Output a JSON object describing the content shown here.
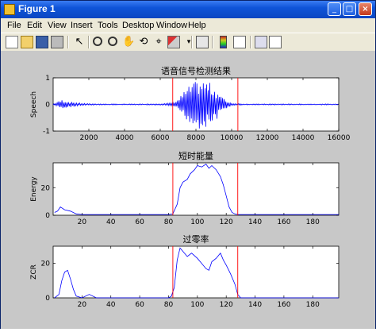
{
  "window": {
    "title": "Figure 1",
    "minimize": "_",
    "maximize": "□",
    "close": "×"
  },
  "menu": [
    "File",
    "Edit",
    "View",
    "Insert",
    "Tools",
    "Desktop",
    "Window",
    "Help"
  ],
  "toolbar": [
    "new-figure-icon",
    "open-file-icon",
    "save-icon",
    "print-icon",
    "edit-plot-arrow-icon",
    "zoom-in-icon",
    "zoom-out-icon",
    "pan-hand-icon",
    "rotate-3d-icon",
    "data-cursor-icon",
    "brush-icon",
    "link-icon",
    "colorbar-icon",
    "legend-icon",
    "hide-plot-tools-icon",
    "show-plot-tools-icon"
  ],
  "colors": {
    "signal": "#0000ff",
    "marker": "#ff0000",
    "figure_bg": "#c8c8c8",
    "axes_bg": "#ffffff"
  },
  "chart_data": [
    {
      "type": "line",
      "title": "语音信号检测结果",
      "xlabel": "",
      "ylabel": "Speech",
      "xlim": [
        0,
        16000
      ],
      "ylim": [
        -1,
        1
      ],
      "xticks": [
        "2000",
        "4000",
        "6000",
        "8000",
        "10000",
        "12000",
        "14000",
        "16000"
      ],
      "yticks": [
        "-1",
        "0",
        "1"
      ],
      "envelope": {
        "x": [
          0,
          500,
          1000,
          1500,
          2000,
          3000,
          4000,
          5000,
          6000,
          6500,
          7000,
          7400,
          7800,
          8200,
          8600,
          9000,
          9300,
          9600,
          10000,
          10500,
          11000,
          12000,
          13000,
          14000,
          15000,
          16000
        ],
        "amplitude": [
          0.02,
          0.18,
          0.1,
          0.05,
          0.03,
          0.02,
          0.02,
          0.02,
          0.03,
          0.05,
          0.2,
          0.55,
          0.8,
          0.92,
          0.9,
          0.7,
          0.45,
          0.2,
          0.05,
          0.03,
          0.02,
          0.02,
          0.02,
          0.02,
          0.02,
          0.02
        ]
      },
      "markers": [
        6700,
        10350
      ]
    },
    {
      "type": "line",
      "title": "短时能量",
      "xlabel": "",
      "ylabel": "Energy",
      "xlim": [
        0,
        198
      ],
      "ylim": [
        0,
        38
      ],
      "xticks": [
        "20",
        "40",
        "60",
        "80",
        "100",
        "120",
        "140",
        "160",
        "180"
      ],
      "yticks": [
        "0",
        "20"
      ],
      "x": [
        1,
        3,
        5,
        8,
        12,
        16,
        20,
        30,
        40,
        60,
        80,
        83,
        86,
        88,
        90,
        93,
        95,
        98,
        100,
        103,
        106,
        108,
        110,
        113,
        116,
        118,
        120,
        122,
        124,
        126,
        128,
        130,
        140,
        160,
        198
      ],
      "y": [
        2,
        3,
        6,
        4,
        3,
        1,
        0.5,
        0.5,
        0.5,
        0.5,
        0.5,
        1,
        8,
        20,
        24,
        26,
        30,
        33,
        36,
        35,
        37,
        34,
        36,
        33,
        28,
        22,
        14,
        6,
        2,
        1,
        0.5,
        0.5,
        0.5,
        0.5,
        0.5
      ],
      "markers": [
        83,
        128
      ]
    },
    {
      "type": "line",
      "title": "过零率",
      "xlabel": "",
      "ylabel": "ZCR",
      "xlim": [
        0,
        198
      ],
      "ylim": [
        0,
        30
      ],
      "xticks": [
        "20",
        "40",
        "60",
        "80",
        "100",
        "120",
        "140",
        "160",
        "180"
      ],
      "yticks": [
        "0",
        "20"
      ],
      "x": [
        1,
        4,
        6,
        8,
        10,
        12,
        14,
        16,
        20,
        25,
        30,
        40,
        60,
        80,
        82,
        84,
        86,
        88,
        90,
        93,
        96,
        100,
        103,
        106,
        108,
        110,
        113,
        116,
        118,
        120,
        123,
        126,
        128,
        130,
        140,
        160,
        198
      ],
      "y": [
        0,
        2,
        10,
        15,
        16,
        11,
        5,
        1,
        0,
        2,
        0,
        0,
        0,
        0,
        1,
        6,
        22,
        29,
        27,
        24,
        26,
        23,
        20,
        17,
        16,
        21,
        23,
        26,
        22,
        19,
        14,
        8,
        2,
        0,
        0,
        0,
        0
      ],
      "markers": [
        83,
        128
      ]
    }
  ]
}
